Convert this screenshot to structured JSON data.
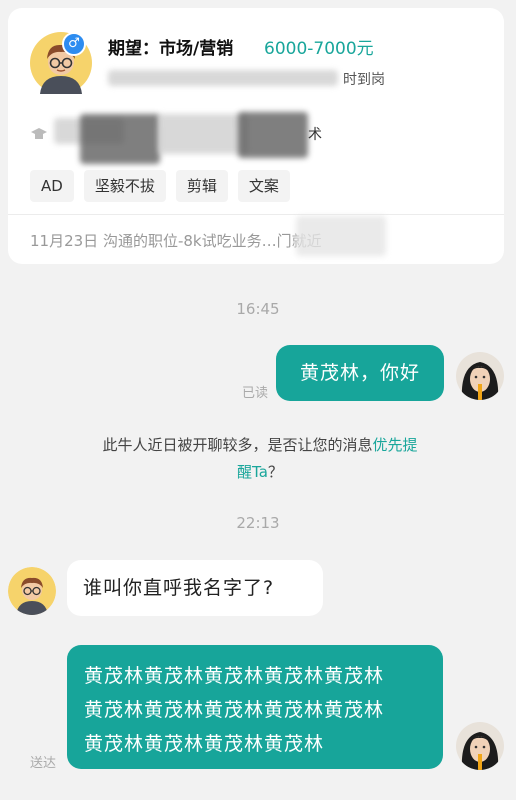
{
  "profile": {
    "expectation_label": "期望：市场/营销",
    "salary": "6000-7000元",
    "gender_symbol": "♂",
    "status_text_fragment": "时到岗",
    "skills_fragment": "术",
    "tags": [
      "AD",
      "坚毅不拔",
      "剪辑",
      "文案"
    ],
    "history": "11月23日 沟通的职位-8k试吃业务…门就近"
  },
  "chat": {
    "time1": "16:45",
    "msg_out_1": "黄茂林，你好",
    "status_read": "已读",
    "system_tip_text": "此牛人近日被开聊较多，是否让您的消息",
    "system_tip_link_1": "优先提",
    "system_tip_link_2": "醒Ta",
    "system_tip_end": "？",
    "time2": "22:13",
    "msg_in_1": "谁叫你直呼我名字了?",
    "msg_out_2_line1": "黄茂林黄茂林黄茂林黄茂林黄茂林",
    "msg_out_2_line2": "黄茂林黄茂林黄茂林黄茂林黄茂林",
    "msg_out_2_line3": "黄茂林黄茂林黄茂林黄茂林",
    "status_delivered": "送达"
  },
  "colors": {
    "accent": "#17a59a",
    "background": "#f2f2f2",
    "bubble_in": "#ffffff"
  }
}
